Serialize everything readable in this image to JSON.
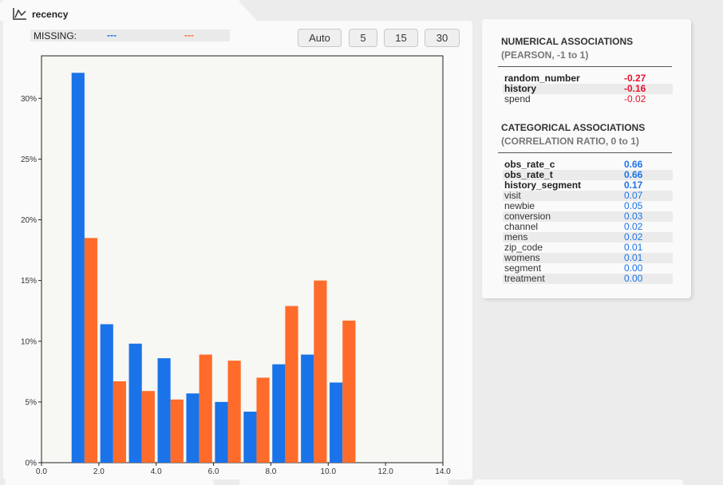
{
  "tab": {
    "title": "recency",
    "icon": "line-chart-icon"
  },
  "missing": {
    "label": "MISSING:",
    "value_a": "---",
    "value_b": "---"
  },
  "bins": {
    "buttons": [
      "Auto",
      "5",
      "15",
      "30"
    ]
  },
  "colors": {
    "series_a": "#1a73e8",
    "series_b": "#ff6b2b",
    "negative": "#e8112d",
    "positive": "#1a73e8"
  },
  "chart_data": {
    "type": "bar",
    "x_ticks": [
      "0.0",
      "2.0",
      "4.0",
      "6.0",
      "8.0",
      "10.0",
      "12.0",
      "14.0"
    ],
    "xlim": [
      0,
      14
    ],
    "y_ticks": [
      "0%",
      "5%",
      "10%",
      "15%",
      "20%",
      "25%",
      "30%"
    ],
    "ylim": [
      0,
      33.5
    ],
    "bin_width": 1,
    "x": [
      1.5,
      2.5,
      3.5,
      4.5,
      5.5,
      6.5,
      7.5,
      8.5,
      9.5,
      10.5,
      11.5
    ],
    "series": [
      {
        "values": [
          32.1,
          11.4,
          9.8,
          8.6,
          5.7,
          5.0,
          4.2,
          8.1,
          8.9,
          6.6,
          null
        ]
      },
      {
        "values": [
          18.5,
          6.7,
          5.9,
          5.2,
          8.9,
          8.4,
          7.0,
          12.9,
          15.0,
          11.7,
          null
        ]
      }
    ]
  },
  "numerical": {
    "title": "NUMERICAL ASSOCIATIONS",
    "subtitle": "(PEARSON, -1 to 1)",
    "rows": [
      {
        "name": "random_number",
        "value": "-0.27",
        "strong": true
      },
      {
        "name": "history",
        "value": "-0.16",
        "strong": true
      },
      {
        "name": "spend",
        "value": "-0.02",
        "strong": false
      }
    ]
  },
  "categorical": {
    "title": "CATEGORICAL ASSOCIATIONS",
    "subtitle": "(CORRELATION RATIO, 0 to 1)",
    "rows": [
      {
        "name": "obs_rate_c",
        "value": "0.66",
        "strong": true
      },
      {
        "name": "obs_rate_t",
        "value": "0.66",
        "strong": true
      },
      {
        "name": "history_segment",
        "value": "0.17",
        "strong": true
      },
      {
        "name": "visit",
        "value": "0.07",
        "strong": false
      },
      {
        "name": "newbie",
        "value": "0.05",
        "strong": false
      },
      {
        "name": "conversion",
        "value": "0.03",
        "strong": false
      },
      {
        "name": "channel",
        "value": "0.02",
        "strong": false
      },
      {
        "name": "mens",
        "value": "0.02",
        "strong": false
      },
      {
        "name": "zip_code",
        "value": "0.01",
        "strong": false
      },
      {
        "name": "womens",
        "value": "0.01",
        "strong": false
      },
      {
        "name": "segment",
        "value": "0.00",
        "strong": false
      },
      {
        "name": "treatment",
        "value": "0.00",
        "strong": false
      }
    ]
  }
}
